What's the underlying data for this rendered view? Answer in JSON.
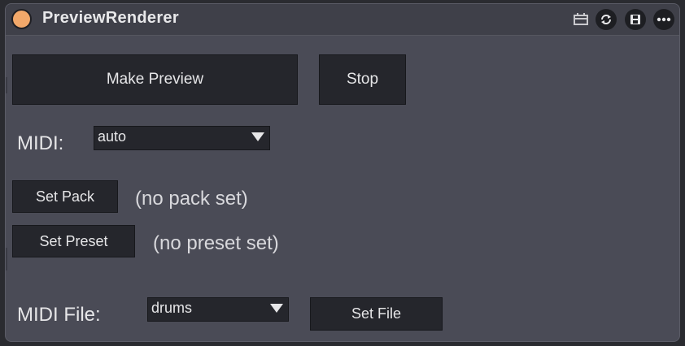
{
  "window": {
    "title": "PreviewRenderer",
    "accent_color": "#f2a86a"
  },
  "titlebar_icons": [
    {
      "name": "calendar-icon"
    },
    {
      "name": "refresh-icon"
    },
    {
      "name": "save-icon"
    },
    {
      "name": "more-icon"
    }
  ],
  "controls": {
    "make_preview_label": "Make Preview",
    "stop_label": "Stop",
    "midi_label": "MIDI:",
    "midi_value": "auto",
    "set_pack_label": "Set Pack",
    "pack_status": "(no pack set)",
    "set_preset_label": "Set Preset",
    "preset_status": "(no preset set)",
    "midi_file_label": "MIDI File:",
    "midi_file_value": "drums",
    "set_file_label": "Set File"
  }
}
